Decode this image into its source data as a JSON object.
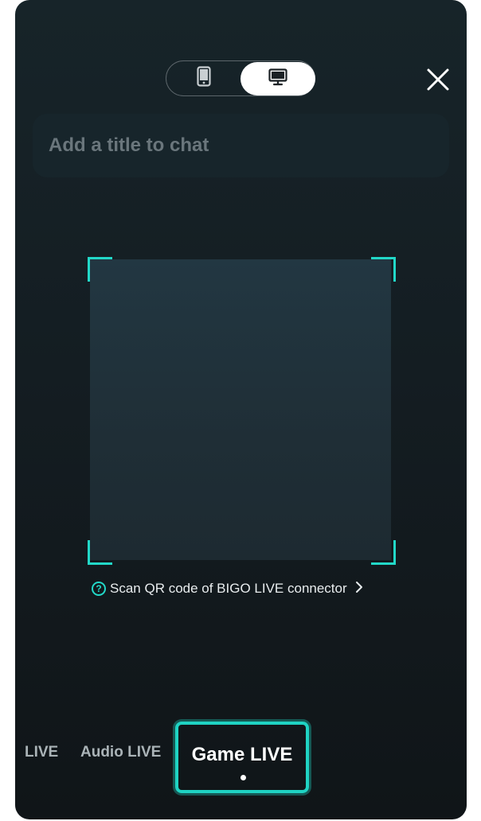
{
  "title_input": {
    "placeholder": "Add a title to chat"
  },
  "device_toggle": {
    "options": [
      {
        "icon": "phone-icon",
        "selected": false
      },
      {
        "icon": "desktop-monitor-icon",
        "selected": true
      }
    ]
  },
  "close": {
    "icon": "close-icon"
  },
  "scan": {
    "help_icon": "question-circle-icon",
    "text": "Scan QR code of BIGO LIVE connector",
    "chevron_icon": "chevron-right-icon"
  },
  "modes": {
    "items": [
      {
        "label": "LIVE",
        "active": false
      },
      {
        "label": "Audio LIVE",
        "active": false
      },
      {
        "label": "Game LIVE",
        "active": true
      }
    ]
  },
  "colors": {
    "accent": "#22d8c8",
    "background_top": "#172429",
    "background_bottom": "#101518",
    "qr_area": "#223742"
  }
}
